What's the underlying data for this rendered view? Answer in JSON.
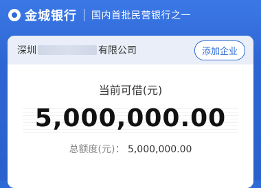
{
  "header": {
    "brand_name": "金城银行",
    "slogan": "国内首批民营银行之一"
  },
  "company": {
    "name_prefix": "深圳",
    "name_suffix": "有限公司",
    "add_button": "添加企业"
  },
  "loan": {
    "label": "当前可借(元)",
    "amount": "5,000,000.00",
    "total_label": "总额度(元)：",
    "total_value": "5,000,000.00"
  },
  "colors": {
    "primary": "#2f6bd6",
    "card_bg": "#ffffff",
    "company_bar_bg": "#e9eef8"
  }
}
